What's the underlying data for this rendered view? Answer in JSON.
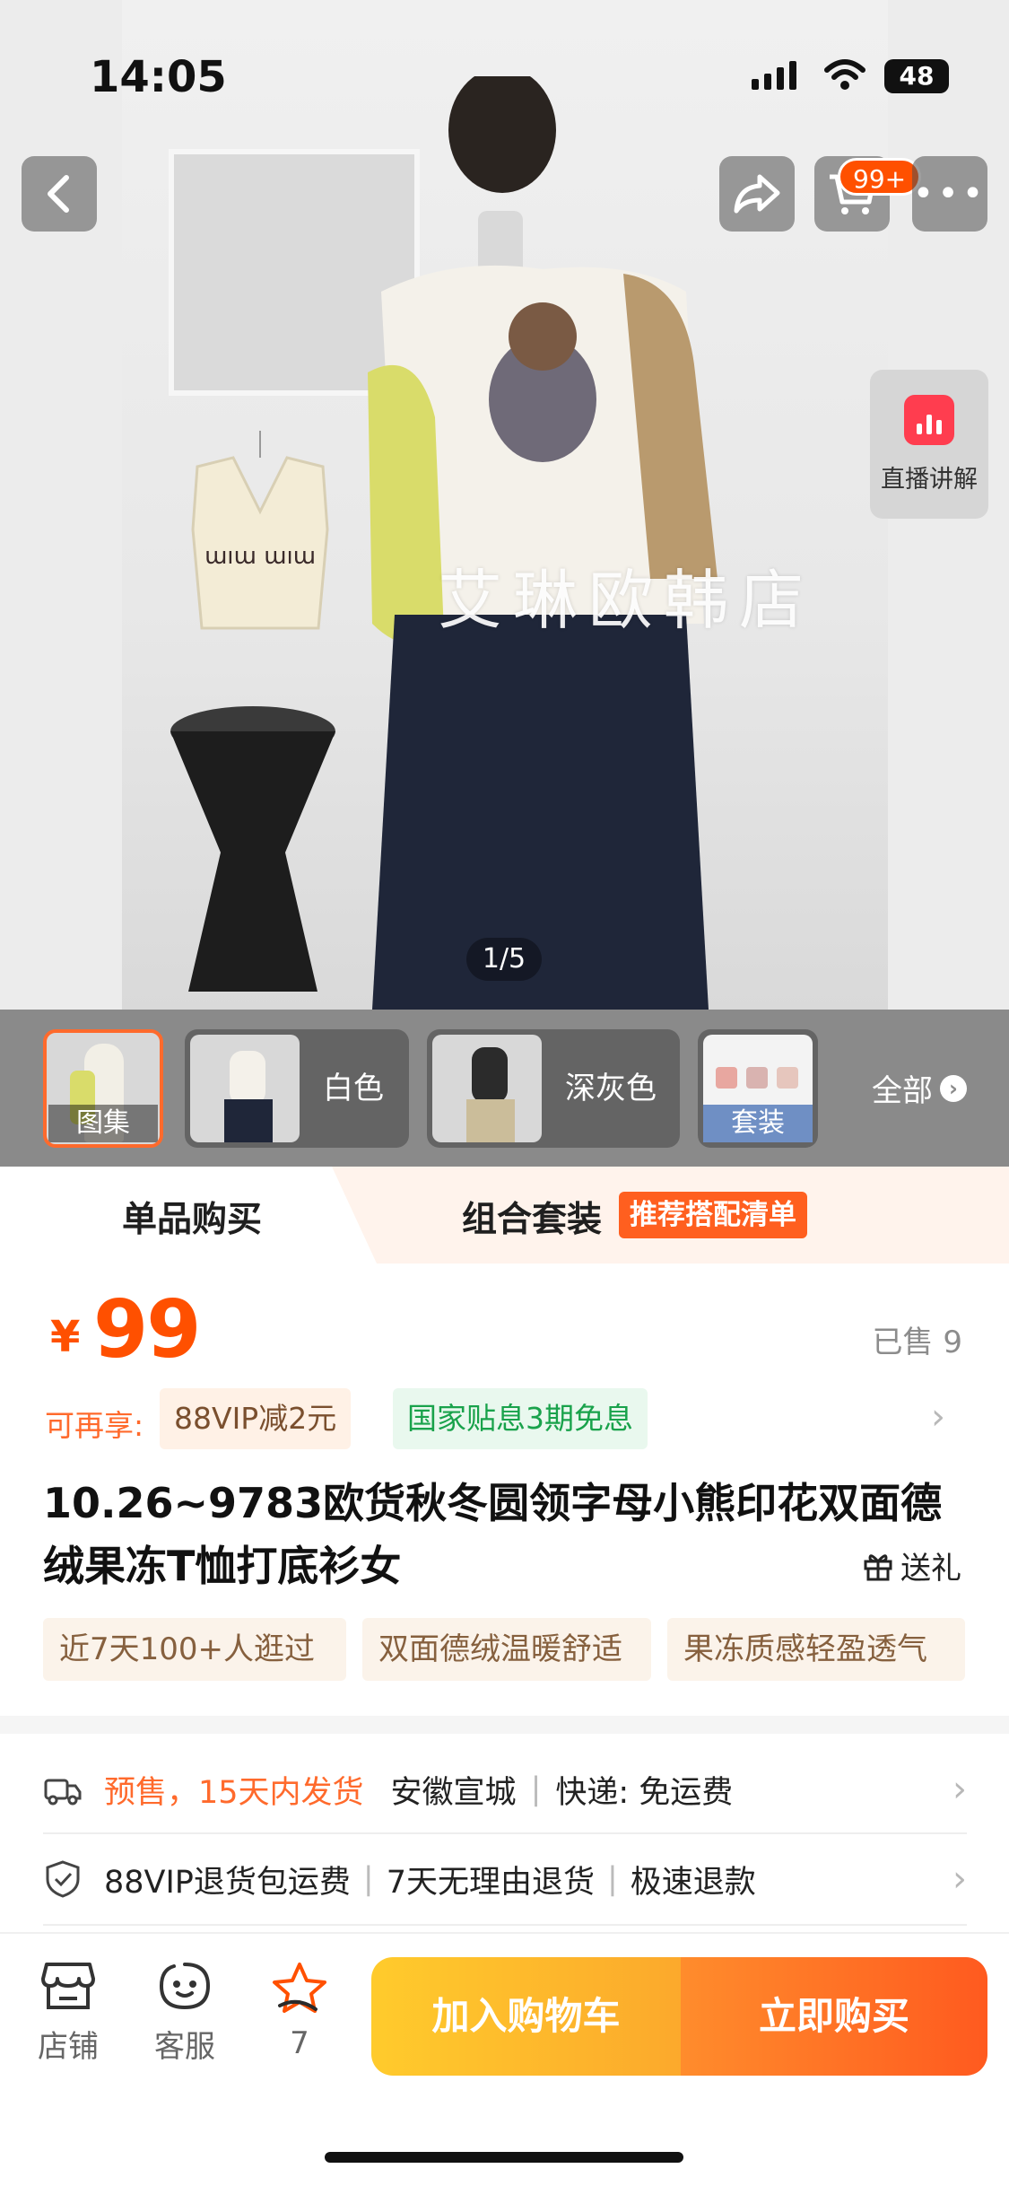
{
  "status_bar": {
    "time": "14:05",
    "battery": "48"
  },
  "top_bar": {
    "cart_badge": "99+"
  },
  "hero": {
    "watermark": "艾琳欧韩店",
    "counter": "1/5",
    "live_label": "直播讲解"
  },
  "thumbnails": [
    {
      "label": "图集",
      "selected": true
    },
    {
      "label": "白色",
      "selected": false
    },
    {
      "label": "深灰色",
      "selected": false
    },
    {
      "label": "套装",
      "selected": false
    }
  ],
  "thumbnails_all": "全部",
  "tabs": {
    "single": "单品购买",
    "combo": "组合套装",
    "combo_tag": "推荐搭配清单"
  },
  "price": {
    "symbol": "¥",
    "value": "99",
    "sold": "已售 9"
  },
  "benefits": {
    "label": "可再享:",
    "vip": "88VIP减2元",
    "gov": "国家贴息3期免息"
  },
  "product": {
    "title": "10.26~9783欧货秋冬圆领字母小熊印花双面德绒果冻T恤打底衫女",
    "gift": "送礼"
  },
  "highlights": [
    "近7天100+人逛过",
    "双面德绒温暖舒适",
    "果冻质感轻盈透气"
  ],
  "shipping": {
    "presale": "预售，15天内发货",
    "origin": "安徽宣城",
    "courier": "快递: 免运费"
  },
  "services": {
    "vip_return": "88VIP退货包运费",
    "no_reason": "7天无理由退货",
    "refund": "极速退款"
  },
  "bottom_bar": {
    "store": "店铺",
    "service": "客服",
    "favorites": "7",
    "add_to_cart": "加入购物车",
    "buy_now": "立即购买"
  },
  "colors": {
    "accent": "#ff5000",
    "green": "#19a24b"
  }
}
